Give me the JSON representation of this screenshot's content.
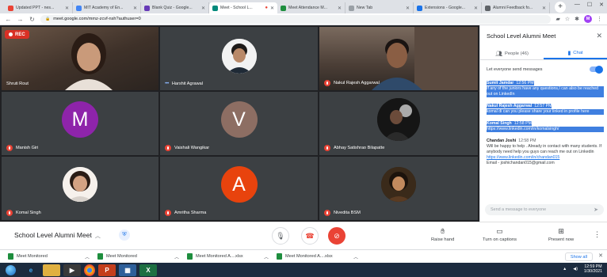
{
  "browser": {
    "tabs": [
      {
        "title": "Updated PPT - nes...",
        "fav": "#ea4335",
        "active": false
      },
      {
        "title": "MIT Academy of En...",
        "fav": "#4285f4",
        "active": false
      },
      {
        "title": "Blank Quiz - Google...",
        "fav": "#673ab7",
        "active": false
      },
      {
        "title": "Meet - School L...",
        "fav": "#00897b",
        "active": true
      },
      {
        "title": "Meet Attendance M...",
        "fav": "#1e8e3e",
        "active": false
      },
      {
        "title": "New Tab",
        "fav": "#9aa0a6",
        "active": false
      },
      {
        "title": "Extensions - Google...",
        "fav": "#1a73e8",
        "active": false
      },
      {
        "title": "Alumni Feedback fo...",
        "fav": "#5f6368",
        "active": false
      }
    ],
    "new_tab": "+",
    "window_controls": {
      "minimize": "—",
      "maximize": "☐",
      "close": "✕"
    },
    "url": "meet.google.com/mmz-zcvf-nsh?authuser=0",
    "profile_initial": "M"
  },
  "meet": {
    "rec_label": "REC",
    "tiles": [
      {
        "name": "Shruti Rout",
        "type": "video",
        "bg": "#5d4a3c"
      },
      {
        "name": "Harshit Agrawal",
        "type": "photo",
        "bg": "#ffffff",
        "speaking": true
      },
      {
        "name": "Nakul Rajesh Aggarwal",
        "type": "video",
        "bg": "#4a3b33"
      },
      {
        "name": "Manish Giri",
        "type": "letter",
        "letter": "M",
        "color": "#8e24aa"
      },
      {
        "name": "Vaishali Wangikar",
        "type": "letter",
        "letter": "V",
        "color": "#8d6e63"
      },
      {
        "name": "Abhay Satishrao Bilapatte",
        "type": "photo",
        "bg": "#3c4043"
      },
      {
        "name": "Komal Singh",
        "type": "photo",
        "bg": "#3c4043"
      },
      {
        "name": "Amritha Sharma",
        "type": "letter",
        "letter": "A",
        "color": "#e8430d"
      },
      {
        "name": "Nivedita BSM",
        "type": "photo",
        "bg": "#3c4043"
      }
    ],
    "meeting_name": "School Level Alumni Meet",
    "actions": {
      "raise_hand": "Raise hand",
      "captions": "Turn on captions",
      "present": "Present now"
    }
  },
  "panel": {
    "title": "School Level Alumni Meet",
    "tabs": {
      "people": "People (46)",
      "chat": "Chat"
    },
    "allow_label": "Let everyone send messages",
    "messages": [
      {
        "sender": "Sumit Jamdar",
        "time": "12:56 PM",
        "lines": [
          "If any of the juniors have any questions,I can also be reached out on LinkedIn"
        ],
        "selected": true
      },
      {
        "sender": "Nakul Rajesh Aggarwal",
        "time": "12:57 PM",
        "lines": [
          "komal di can you please share your linked in profile here"
        ],
        "selected": true
      },
      {
        "sender": "Komal Singh",
        "time": "12:58 PM",
        "lines": [],
        "link": "https://www.linkedin.com/in/komalsingh/",
        "selected": true
      },
      {
        "sender": "Chandan Joshi",
        "time": "12:58 PM",
        "lines": [
          "Will be happy to help . Already in contact with many students. If anybody need help you guys can reach me out on Linkedin"
        ],
        "link": "https://www.linkedin.com/in/chandan015",
        "extra": "Email - joshichandan015@gmail.com",
        "selected": false
      }
    ],
    "send_placeholder": "Send a message to everyone"
  },
  "shelf": {
    "items": [
      "Meet Monitored",
      "Meet Monitored",
      "Meet Monitored A....xlsx",
      "Meet Monitored A....xlsx"
    ],
    "show_all": "Show all"
  },
  "taskbar": {
    "time": "12:59 PM",
    "date": "1/30/2021"
  }
}
